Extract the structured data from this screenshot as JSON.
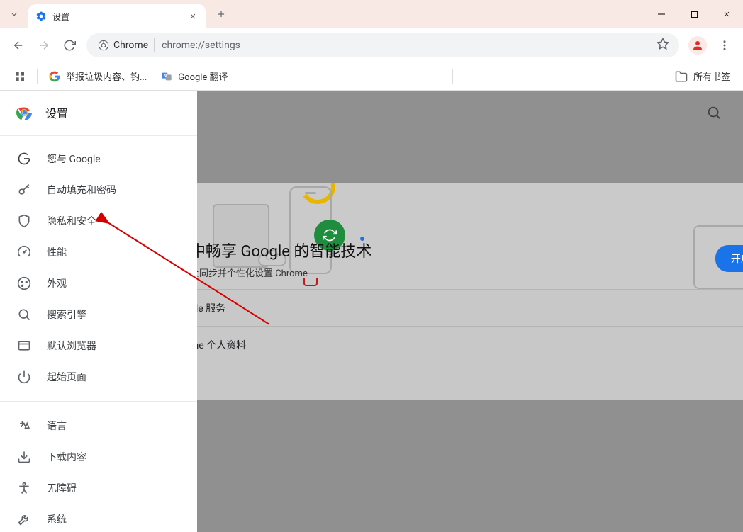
{
  "window": {
    "tab_title": "设置",
    "url_chip": "Chrome",
    "url": "chrome://settings"
  },
  "bookmarks": {
    "item1": "举报垃圾内容、钓...",
    "item2": "Google 翻译",
    "all": "所有书签"
  },
  "sidebar": {
    "title": "设置",
    "items": {
      "google": "您与 Google",
      "autofill": "自动填充和密码",
      "privacy": "隐私和安全",
      "performance": "性能",
      "appearance": "外观",
      "search": "搜索引擎",
      "default_browser": "默认浏览器",
      "startup": "起始页面",
      "language": "语言",
      "downloads": "下载内容",
      "accessibility": "无障碍",
      "system": "系统"
    }
  },
  "main": {
    "hero_title": "中畅享 Google 的智能技术",
    "hero_sub": "上同步并个性化设置 Chrome",
    "sync_button": "开启同步功能...",
    "row1": "gle 服务",
    "row2": "me 个人资料"
  }
}
